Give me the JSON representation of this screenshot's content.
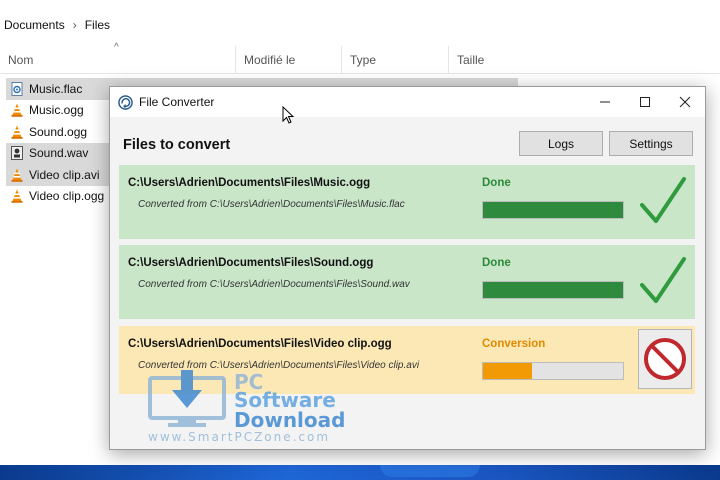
{
  "explorer": {
    "breadcrumb": [
      "Documents",
      "Files"
    ],
    "columns": {
      "name": "Nom",
      "date": "Modifié le",
      "type": "Type",
      "size": "Taille"
    },
    "files": [
      {
        "name": "Music.flac",
        "icon": "audio-file-icon",
        "selected": true
      },
      {
        "name": "Music.ogg",
        "icon": "vlc-cone-icon",
        "selected": false
      },
      {
        "name": "Sound.ogg",
        "icon": "vlc-cone-icon",
        "selected": false
      },
      {
        "name": "Sound.wav",
        "icon": "wav-file-icon",
        "selected": true
      },
      {
        "name": "Video clip.avi",
        "icon": "vlc-cone-icon",
        "selected": true
      },
      {
        "name": "Video clip.ogg",
        "icon": "vlc-cone-icon",
        "selected": false
      }
    ]
  },
  "window": {
    "title": "File Converter",
    "section_title": "Files to convert",
    "buttons": {
      "logs": "Logs",
      "settings": "Settings"
    }
  },
  "jobs": [
    {
      "path": "C:\\Users\\Adrien\\Documents\\Files\\Music.ogg",
      "source": "Converted from C:\\Users\\Adrien\\Documents\\Files\\Music.flac",
      "status": "Done",
      "progress": 1.0
    },
    {
      "path": "C:\\Users\\Adrien\\Documents\\Files\\Sound.ogg",
      "source": "Converted from C:\\Users\\Adrien\\Documents\\Files\\Sound.wav",
      "status": "Done",
      "progress": 1.0
    },
    {
      "path": "C:\\Users\\Adrien\\Documents\\Files\\Video clip.ogg",
      "source": "Converted from C:\\Users\\Adrien\\Documents\\Files\\Video clip.avi",
      "status": "Conversion",
      "progress": 0.35
    }
  ],
  "watermark": {
    "line1": "PC",
    "line2": "Software",
    "line3": "Download",
    "site": "www.SmartPCZone.com"
  },
  "colors": {
    "done_bg": "#c9e6c9",
    "active_bg": "#fbe8b5",
    "done_accent": "#2e8b3e",
    "active_accent": "#f29a05",
    "cancel_red": "#c0282d"
  }
}
